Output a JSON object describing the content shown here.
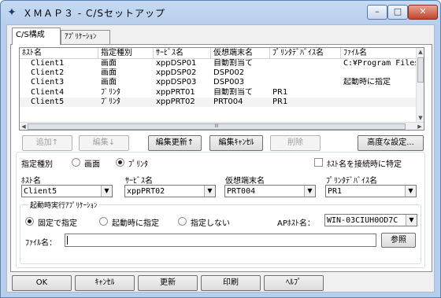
{
  "window": {
    "title": "ＸＭＡＰ３ - C/Sセットアップ",
    "icon": "xmap-app-icon",
    "controls": {
      "minimize": "–",
      "maximize": "□",
      "close": "✕"
    }
  },
  "tabs": [
    {
      "label": "C/S構成",
      "active": true
    },
    {
      "label": "ｱﾌﾟﾘｹｰｼｮﾝ",
      "active": false
    }
  ],
  "list": {
    "columns": [
      "ﾎｽﾄ名",
      "指定種別",
      "ｻｰﾋﾞｽ名",
      "仮想端末名",
      "ﾌﾟﾘﾝﾀﾃﾞﾊﾞｲｽ名",
      "ﾌｧｲﾙ名"
    ],
    "rows": [
      [
        "Client1",
        "画面",
        "xppDSP01",
        "自動割当て",
        "",
        "C:¥Program Files"
      ],
      [
        "Client2",
        "画面",
        "xppDSP02",
        "DSP002",
        "",
        ""
      ],
      [
        "Client3",
        "画面",
        "xppDSP03",
        "DSP003",
        "",
        "起動時に指定"
      ],
      [
        "Client4",
        "ﾌﾟﾘﾝﾀ",
        "xppPRT01",
        "自動割当て",
        "PR1",
        ""
      ],
      [
        "Client5",
        "ﾌﾟﾘﾝﾀ",
        "xppPRT02",
        "PRT004",
        "PR1",
        ""
      ]
    ],
    "hscroll_grip": "III"
  },
  "list_buttons": {
    "add": "追加↑",
    "edit": "編集↓",
    "update": "編集更新↑",
    "cancel": "編集ｷｬﾝｾﾙ",
    "delete": "削除",
    "advanced": "高度な設定..."
  },
  "form": {
    "type_label": "指定種別",
    "type_screen": "画面",
    "type_printer": "ﾌﾟﾘﾝﾀ",
    "host_connect_label": "ﾎｽﾄ名を接続時に特定",
    "host_label": "ﾎｽﾄ名",
    "host_value": "Client5",
    "service_label": "ｻｰﾋﾞｽ名",
    "service_value": "xppPRT02",
    "terminal_label": "仮想端末名",
    "terminal_value": "PRT004",
    "printer_label": "ﾌﾟﾘﾝﾀﾃﾞﾊﾞｲｽ名",
    "printer_value": "PR1",
    "startup_group": "起動時実行ｱﾌﾟﾘｹｰｼｮﾝ",
    "opt_fixed": "固定で指定",
    "opt_startup": "起動時に指定",
    "opt_none": "指定しない",
    "ap_host_label": "APﾎｽﾄ名：",
    "ap_host_value": "WIN-03CIUH0OD7C",
    "file_label": "ﾌｧｲﾙ名：",
    "file_value": "",
    "browse": "参照"
  },
  "footer": {
    "ok": "OK",
    "cancel": "ｷｬﾝｾﾙ",
    "update": "更新",
    "print": "印刷",
    "help": "ﾍﾙﾌﾟ"
  }
}
